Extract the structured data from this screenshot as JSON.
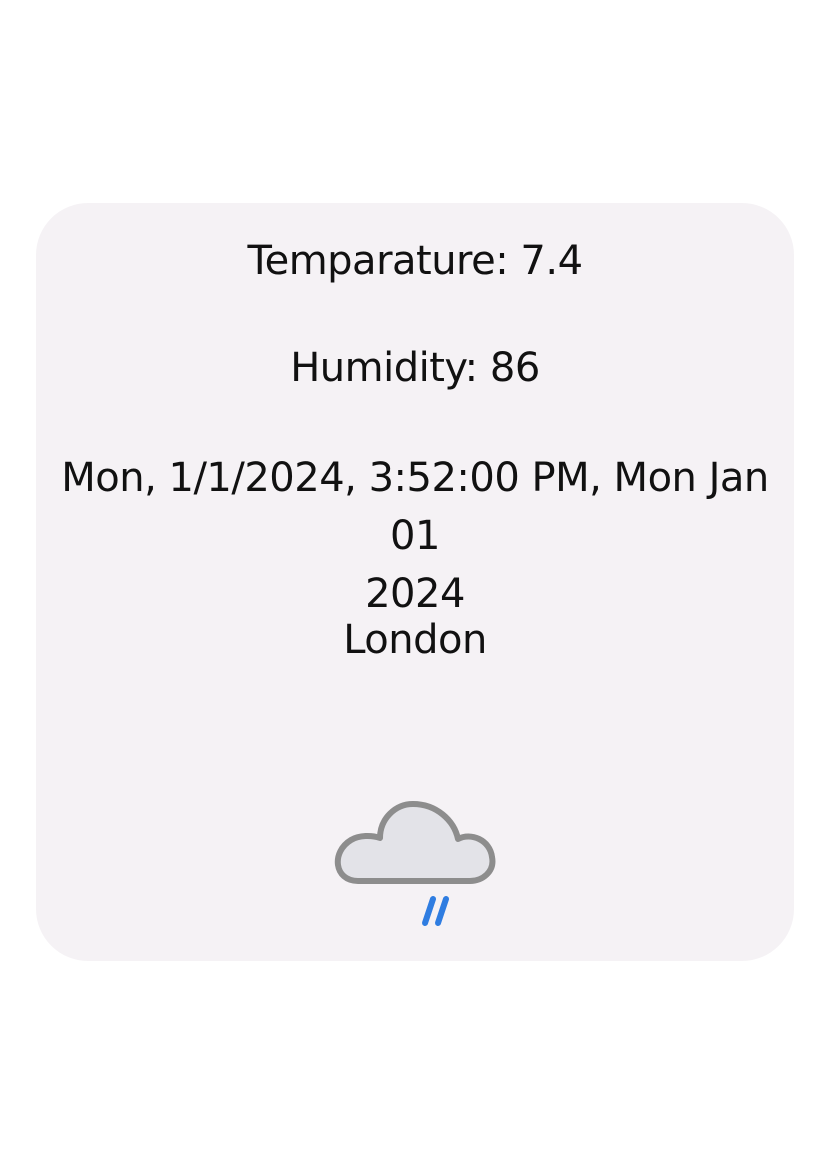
{
  "weather": {
    "temperature_text": "Temparature: 7.4",
    "humidity_text": "Humidity: 86",
    "datetime_line1": "Mon, 1/1/2024, 3:52:00 PM, Mon Jan 01",
    "datetime_line2": "2024",
    "city": "London",
    "icon": "rain-cloud-icon"
  },
  "colors": {
    "card_background": "#f5f2f5",
    "cloud_fill": "#e3e3e8",
    "cloud_outline": "#8d8d8d",
    "rain": "#2f7de1"
  }
}
